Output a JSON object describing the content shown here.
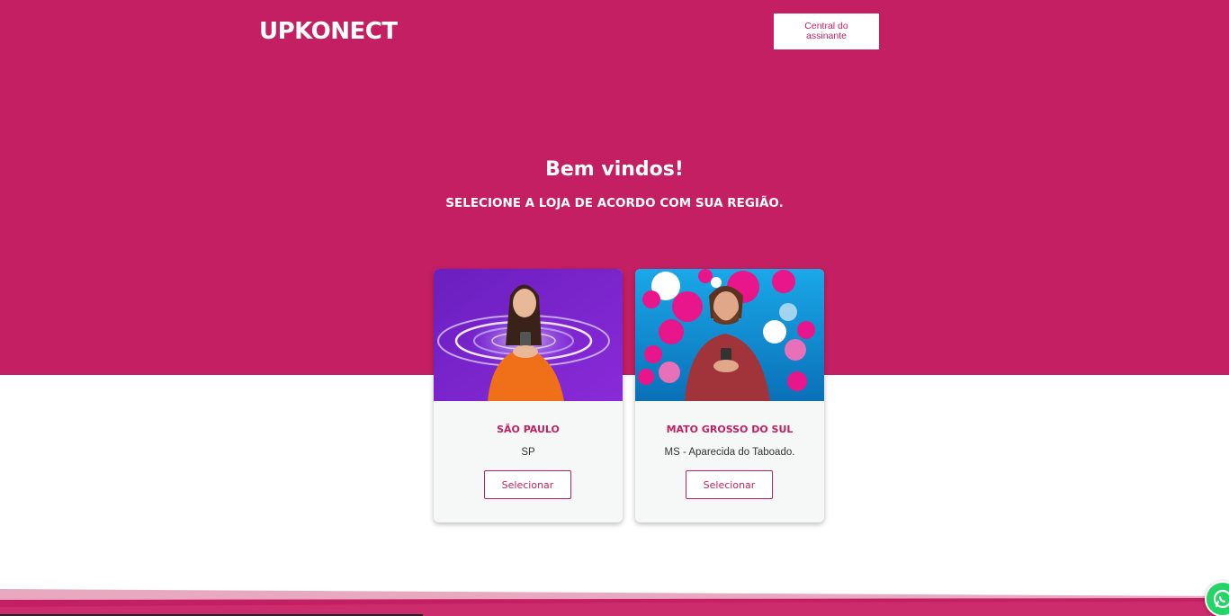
{
  "header": {
    "logo_text": "UPKONECT",
    "central_button_label": "Central do assinante"
  },
  "hero": {
    "title": "Bem vindos!",
    "subtitle": "SELECIONE A LOJA DE ACORDO COM SUA REGIÃO."
  },
  "stores": [
    {
      "name": "SÃO PAULO",
      "region": "SP",
      "button_label": "Selecionar"
    },
    {
      "name": "MATO GROSSO DO SUL",
      "region": "MS - Aparecida do Taboado.",
      "button_label": "Selecionar"
    }
  ],
  "colors": {
    "brand": "#c41f62",
    "whatsapp": "#25d366"
  },
  "icons": {
    "whatsapp": "whatsapp-icon"
  }
}
